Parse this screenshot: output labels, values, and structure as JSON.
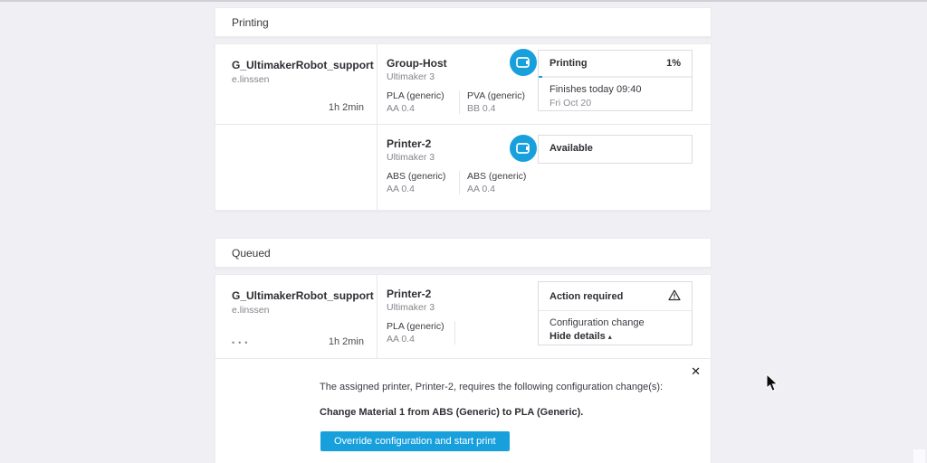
{
  "colors": {
    "accent": "#18a0dd",
    "page_bg": "#f0f0f4"
  },
  "printing": {
    "header": "Printing",
    "row1": {
      "job": "G_UltimakerRobot_support",
      "owner": "e.linssen",
      "duration": "1h 2min",
      "printer": "Group-Host",
      "model": "Ultimaker 3",
      "material1": "PLA (generic)",
      "core1": "AA 0.4",
      "material2": "PVA (generic)",
      "core2": "BB 0.4",
      "status": "Printing",
      "progress": "1%",
      "finish_line": "Finishes today 09:40",
      "finish_date": "Fri Oct 20"
    },
    "row2": {
      "printer": "Printer-2",
      "model": "Ultimaker 3",
      "material1": "ABS (generic)",
      "core1": "AA 0.4",
      "material2": "ABS (generic)",
      "core2": "AA 0.4",
      "status": "Available"
    }
  },
  "queued": {
    "header": "Queued",
    "row": {
      "job": "G_UltimakerRobot_support",
      "owner": "e.linssen",
      "menu": "•••",
      "duration": "1h 2min",
      "printer": "Printer-2",
      "model": "Ultimaker 3",
      "material1": "PLA (generic)",
      "core1": "AA 0.4",
      "status": "Action required",
      "config_label": "Configuration change",
      "toggle_label": "Hide details",
      "toggle_caret": "▴"
    },
    "details": {
      "close": "✕",
      "message": "The assigned printer, Printer-2, requires the following configuration change(s):",
      "change": "Change Material 1 from ABS (Generic) to PLA (Generic).",
      "button": "Override configuration and start print"
    }
  }
}
